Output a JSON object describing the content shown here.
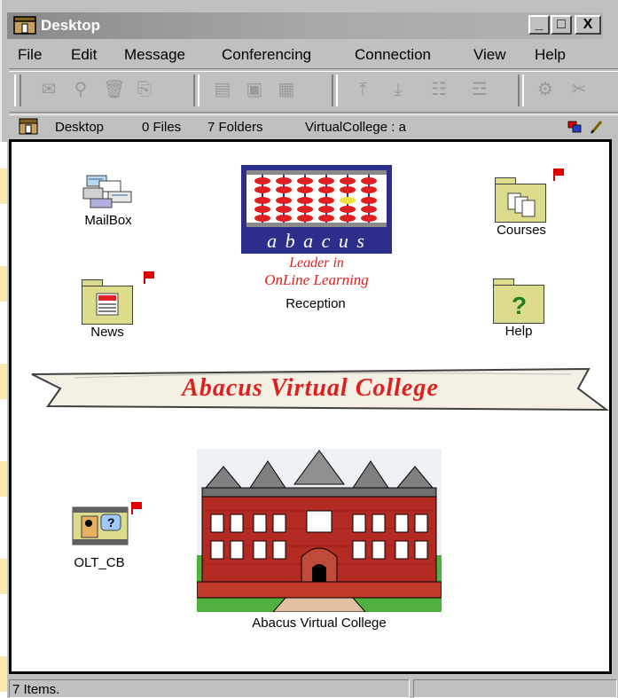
{
  "window": {
    "title": "Desktop",
    "minimize_glyph": "_",
    "maximize_glyph": "□",
    "close_glyph": "X"
  },
  "menu": [
    "File",
    "Edit",
    "Message",
    "Conferencing",
    "Connection",
    "View",
    "Help"
  ],
  "pathbar": {
    "location": "Desktop",
    "files": "0 Files",
    "folders": "7 Folders",
    "server": "VirtualCollege : a"
  },
  "icons": {
    "mailbox": "MailBox",
    "reception": "Reception",
    "courses": "Courses",
    "news": "News",
    "help": "Help",
    "olt_cb": "OLT_CB",
    "college": "Abacus Virtual College"
  },
  "logo": {
    "word": "a b a c u s",
    "tagline_1": "Leader in",
    "tagline_2": "OnLine Learning"
  },
  "banner": {
    "text": "Abacus Virtual College"
  },
  "statusbar": {
    "items": "7 Items."
  },
  "colors": {
    "titlebar": "#9a9a9a",
    "chrome": "#c0c0c0",
    "folder": "#dcdc8c",
    "flag": "#e00000",
    "logo_bg": "#2d2d8c",
    "brick": "#b22a22"
  }
}
